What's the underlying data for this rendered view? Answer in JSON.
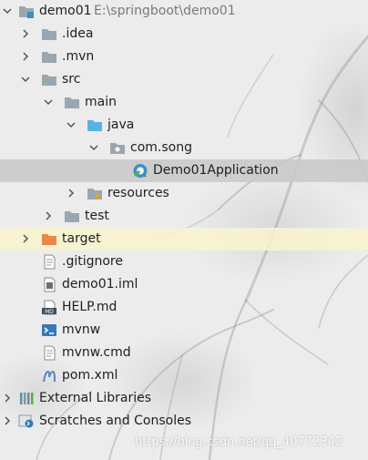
{
  "project": {
    "name": "demo01",
    "path": "E:\\springboot\\demo01"
  },
  "tree": {
    "idea": ".idea",
    "mvn": ".mvn",
    "src": "src",
    "main": "main",
    "java": "java",
    "package": "com.song",
    "app_class": "Demo01Application",
    "resources": "resources",
    "test": "test",
    "target": "target",
    "gitignore": ".gitignore",
    "iml": "demo01.iml",
    "help": "HELP.md",
    "mvnw": "mvnw",
    "mvnw_cmd": "mvnw.cmd",
    "pom": "pom.xml",
    "external_libraries": "External Libraries",
    "scratches": "Scratches and Consoles"
  },
  "icons": {
    "md_badge": "MD"
  },
  "watermark": "https://blog.csdn.net/qq_40772342",
  "colors": {
    "folder": "#9aa7b0",
    "source_folder": "#59b3e0",
    "excluded_folder": "#e8894a",
    "selection": "#c8c8c8",
    "excluded_row": "#f8f4ce"
  }
}
